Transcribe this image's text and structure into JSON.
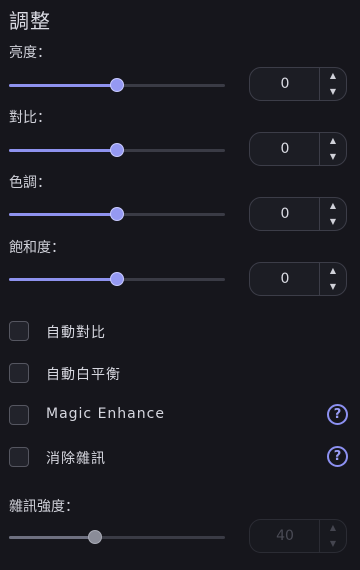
{
  "panel": {
    "title": "調整",
    "sliders": [
      {
        "label": "亮度：",
        "value": "0",
        "position": 0.5,
        "enabled": true
      },
      {
        "label": "對比：",
        "value": "0",
        "position": 0.5,
        "enabled": true
      },
      {
        "label": "色調：",
        "value": "0",
        "position": 0.5,
        "enabled": true
      },
      {
        "label": "飽和度：",
        "value": "0",
        "position": 0.5,
        "enabled": true
      }
    ],
    "checkboxes": [
      {
        "label": "自動對比",
        "checked": false,
        "help": false
      },
      {
        "label": "自動白平衡",
        "checked": false,
        "help": false
      },
      {
        "label": "Magic Enhance",
        "checked": false,
        "help": true
      },
      {
        "label": "消除雜訊",
        "checked": false,
        "help": true
      }
    ],
    "noise": {
      "label": "雜訊強度：",
      "value": "40",
      "position": 0.4,
      "enabled": false
    }
  },
  "icons": {
    "help": "help-circle-icon",
    "spin_up": "caret-up-icon",
    "spin_down": "caret-down-icon"
  },
  "colors": {
    "background": "#16161c",
    "accent": "#8e92ee",
    "track": "#3a3b45"
  }
}
